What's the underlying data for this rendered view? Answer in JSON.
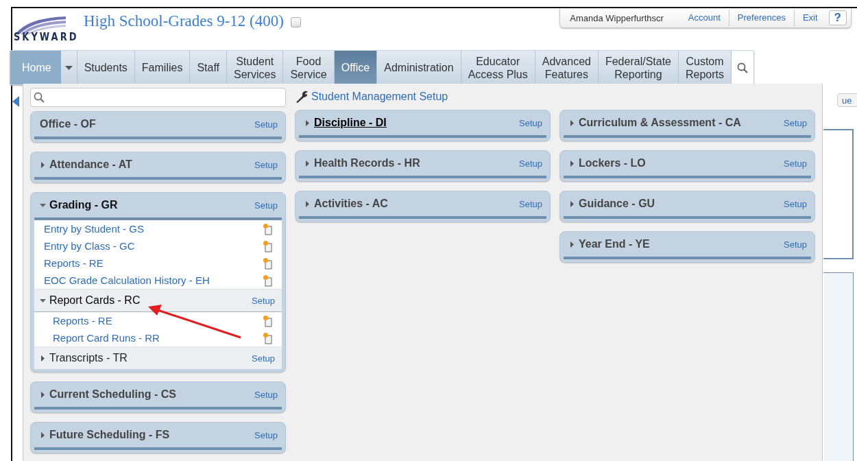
{
  "header": {
    "logo_text": "SKYWARD",
    "title": "High School-Grades 9-12 (400)"
  },
  "user_bar": {
    "user_name": "Amanda Wipperfurthscr",
    "links": [
      "Account",
      "Preferences",
      "Exit"
    ],
    "help": "?"
  },
  "nav": [
    {
      "kind": "home",
      "label": "Home",
      "selected": false
    },
    {
      "kind": "tab",
      "label": "Students",
      "selected": false
    },
    {
      "kind": "tab",
      "label": "Families",
      "selected": false
    },
    {
      "kind": "tab",
      "label": "Staff",
      "selected": false
    },
    {
      "kind": "tab",
      "label": "Student\nServices",
      "selected": false
    },
    {
      "kind": "tab",
      "label": "Food\nService",
      "selected": false
    },
    {
      "kind": "tab",
      "label": "Office",
      "selected": true
    },
    {
      "kind": "tab",
      "label": "Administration",
      "selected": false
    },
    {
      "kind": "tab",
      "label": "Educator\nAccess Plus",
      "selected": false
    },
    {
      "kind": "tab",
      "label": "Advanced\nFeatures",
      "selected": false
    },
    {
      "kind": "tab",
      "label": "Federal/State\nReporting",
      "selected": false
    },
    {
      "kind": "tab",
      "label": "Custom\nReports",
      "selected": false
    }
  ],
  "menu": {
    "setup_link": "Student Management Setup",
    "columns": [
      [
        {
          "title": "Office - OF",
          "setup": "Setup",
          "kind": "static",
          "hovered": false
        },
        {
          "title": "Attendance - AT",
          "setup": "Setup",
          "kind": "collapsible",
          "expanded": false,
          "hovered": false
        },
        {
          "title": "Grading - GR",
          "setup": "Setup",
          "kind": "collapsible",
          "expanded": true,
          "hovered": false,
          "items": [
            {
              "kind": "link",
              "label": "Entry by Student - GS"
            },
            {
              "kind": "link",
              "label": "Entry by Class - GC"
            },
            {
              "kind": "link",
              "label": "Reports - RE"
            },
            {
              "kind": "link",
              "label": "EOC Grade Calculation History - EH"
            },
            {
              "kind": "group",
              "label": "Report Cards - RC",
              "setup": "Setup",
              "expanded": true,
              "children": [
                {
                  "kind": "link",
                  "label": "Reports - RE"
                },
                {
                  "kind": "link",
                  "label": "Report Card Runs - RR"
                }
              ]
            },
            {
              "kind": "group",
              "label": "Transcripts - TR",
              "setup": "Setup",
              "expanded": false
            }
          ]
        },
        {
          "title": "Current Scheduling - CS",
          "setup": "Setup",
          "kind": "collapsible",
          "expanded": false,
          "hovered": false
        },
        {
          "title": "Future Scheduling - FS",
          "setup": "Setup",
          "kind": "collapsible",
          "expanded": false,
          "hovered": false
        }
      ],
      [
        {
          "title": "Discipline - DI",
          "setup": "Setup",
          "kind": "collapsible",
          "expanded": false,
          "hovered": true
        },
        {
          "title": "Health Records - HR",
          "setup": "Setup",
          "kind": "collapsible",
          "expanded": false,
          "hovered": false
        },
        {
          "title": "Activities - AC",
          "setup": "Setup",
          "kind": "collapsible",
          "expanded": false,
          "hovered": false
        }
      ],
      [
        {
          "title": "Curriculum & Assessment - CA",
          "setup": "Setup",
          "kind": "collapsible",
          "expanded": false,
          "hovered": false
        },
        {
          "title": "Lockers - LO",
          "setup": "Setup",
          "kind": "collapsible",
          "expanded": false,
          "hovered": false
        },
        {
          "title": "Guidance - GU",
          "setup": "Setup",
          "kind": "collapsible",
          "expanded": false,
          "hovered": false
        },
        {
          "title": "Year End - YE",
          "setup": "Setup",
          "kind": "collapsible",
          "expanded": false,
          "hovered": false
        }
      ]
    ]
  },
  "background": {
    "partial_button": "ue"
  }
}
